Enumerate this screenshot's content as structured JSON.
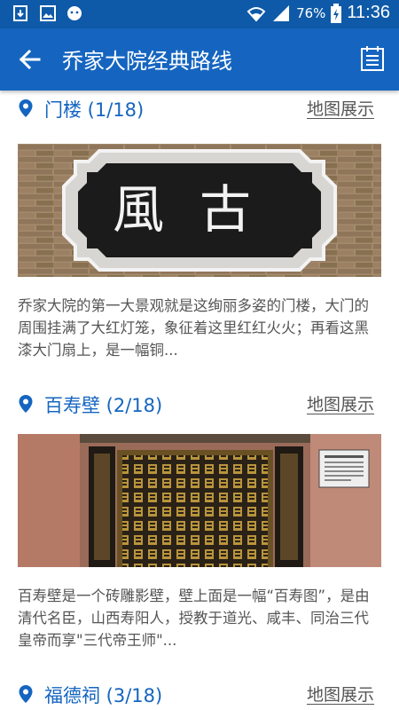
{
  "status_bar": {
    "battery": "76%",
    "time": "11:36"
  },
  "app_bar": {
    "title": "乔家大院经典路线"
  },
  "sections": [
    {
      "title": "门楼 (1/18)",
      "map_link": "地图展示",
      "image_text": "風古",
      "description": "乔家大院的第一大景观就是这绚丽多姿的门楼，大门的周围挂满了大红灯笼，象征着这里红红火火；再看这黑漆大门扇上，是一幅铜..."
    },
    {
      "title": "百寿壁 (2/18)",
      "map_link": "地图展示",
      "description": "百寿壁是一个砖雕影壁，壁上面是一幅“百寿图”，是由清代名臣，山西寿阳人，授教于道光、咸丰、同治三代皇帝而享\"三代帝王师\"..."
    },
    {
      "title": "福德祠 (3/18)",
      "map_link": "地图展示"
    }
  ],
  "icons": {
    "back": "arrow-left-icon",
    "calendar": "calendar-icon",
    "pin": "location-pin-icon"
  },
  "colors": {
    "status_bar": "#0e5aa8",
    "app_bar": "#1565c0",
    "section_title": "#1565c0",
    "description": "#555555"
  }
}
